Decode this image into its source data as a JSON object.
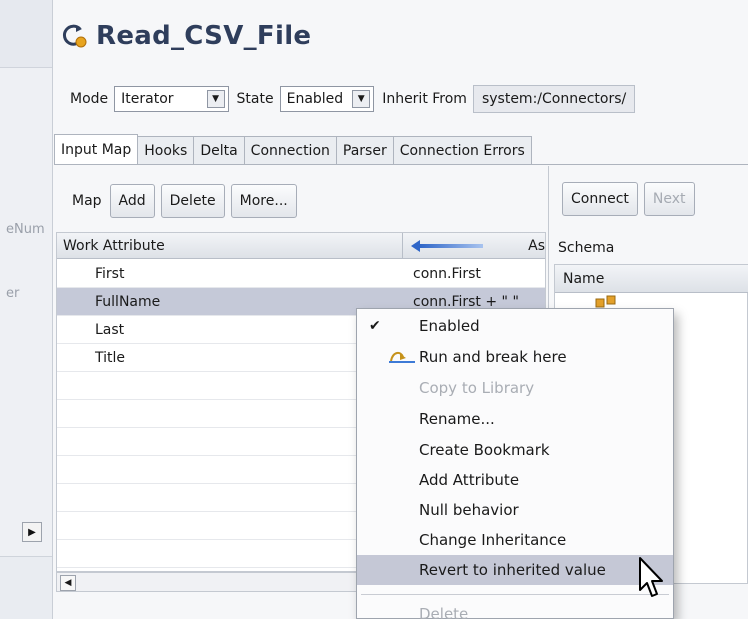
{
  "window": {
    "title": "Read_CSV_File",
    "title_icon": "connector-refresh-icon"
  },
  "left_strip": {
    "ghost_label_1": "eNum",
    "ghost_label_2": "er"
  },
  "config": {
    "mode_label": "Mode",
    "mode_value": "Iterator",
    "state_label": "State",
    "state_value": "Enabled",
    "inherit_label": "Inherit From",
    "inherit_value": "system:/Connectors/"
  },
  "tabs": [
    {
      "label": "Input Map",
      "active": true
    },
    {
      "label": "Hooks",
      "active": false
    },
    {
      "label": "Delta",
      "active": false
    },
    {
      "label": "Connection",
      "active": false
    },
    {
      "label": "Parser",
      "active": false
    },
    {
      "label": "Connection Errors",
      "active": false
    }
  ],
  "map_toolbar": {
    "map_label": "Map",
    "add_label": "Add",
    "delete_label": "Delete",
    "more_label": "More..."
  },
  "grid": {
    "col_work": "Work Attribute",
    "col_as": "As",
    "rows": [
      {
        "attr": "First",
        "assign": "conn.First",
        "selected": false
      },
      {
        "attr": "FullName",
        "assign": "conn.First + \" \"",
        "selected": true
      },
      {
        "attr": "Last",
        "assign": "",
        "selected": false
      },
      {
        "attr": "Title",
        "assign": "",
        "selected": false
      }
    ]
  },
  "right_toolbar": {
    "connect_label": "Connect",
    "next_label": "Next"
  },
  "schema": {
    "label": "Schema",
    "col_name": "Name"
  },
  "context_menu": {
    "items": [
      {
        "label": "Enabled",
        "checked": true,
        "disabled": false
      },
      {
        "label": "Run and break here",
        "icon": "run-break-icon",
        "disabled": false
      },
      {
        "label": "Copy to Library",
        "disabled": true
      },
      {
        "label": "Rename...",
        "disabled": false
      },
      {
        "label": "Create Bookmark",
        "disabled": false
      },
      {
        "label": "Add Attribute",
        "disabled": false
      },
      {
        "label": "Null behavior",
        "disabled": false
      },
      {
        "label": "Change Inheritance",
        "disabled": false
      },
      {
        "label": "Revert to inherited value",
        "disabled": false,
        "hover": true
      },
      {
        "label": "Delete",
        "disabled": true
      }
    ]
  },
  "colors": {
    "title": "#2f3e5c",
    "selection": "#c5c9d8",
    "menu_hover": "#c5c8d6",
    "arrow_blue": "#2f66c8"
  }
}
